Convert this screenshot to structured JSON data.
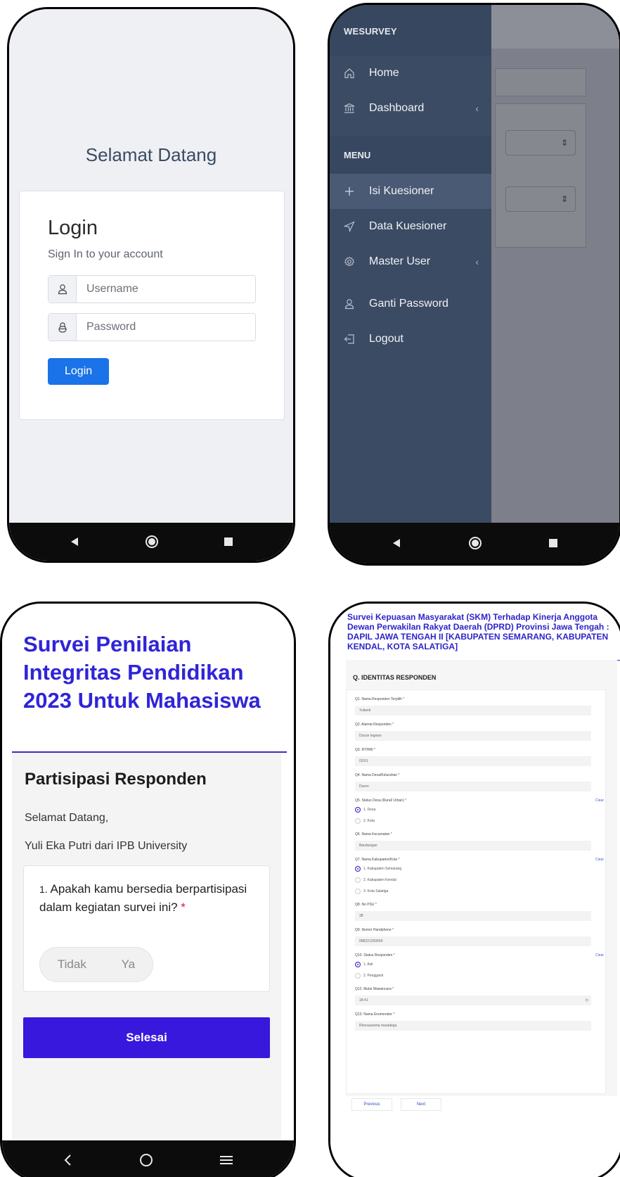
{
  "login_screen": {
    "welcome": "Selamat Datang",
    "title": "Login",
    "subtitle": "Sign In to your account",
    "username_placeholder": "Username",
    "password_placeholder": "Password",
    "login_button": "Login"
  },
  "sidebar_screen": {
    "brand": "WESURVEY",
    "items_top": [
      {
        "label": "Home",
        "icon": "home-icon"
      },
      {
        "label": "Dashboard",
        "icon": "bank-icon"
      }
    ],
    "menu_title": "MENU",
    "items_menu": [
      {
        "label": "Isi Kuesioner",
        "icon": "plus-icon"
      },
      {
        "label": "Data Kuesioner",
        "icon": "send-icon"
      },
      {
        "label": "Master User",
        "icon": "gear-icon"
      },
      {
        "label": "Ganti Password",
        "icon": "user-icon"
      },
      {
        "label": "Logout",
        "icon": "logout-icon"
      }
    ],
    "expand_marker": "‹"
  },
  "survey_screen": {
    "title": "Survei Penilaian Integritas Pendidikan 2023 Untuk Mahasiswa",
    "heading": "Partisipasi Responden",
    "greeting": "Selamat Datang,",
    "respondent": "Yuli Eka Putri dari IPB University",
    "question_number": "1.",
    "question_text": "Apakah kamu bersedia berpartisipasi dalam kegiatan survei ini?",
    "required_mark": "*",
    "option_no": "Tidak",
    "option_yes": "Ya",
    "submit": "Selesai"
  },
  "skm_screen": {
    "title": "Survei Kepuasan Masyarakat (SKM) Terhadap Kinerja Anggota Dewan Perwakilan Rakyat Daerah (DPRD) Provinsi Jawa Tengah : DAPIL JAWA TENGAH II [KABUPATEN SEMARANG, KABUPATEN KENDAL, KOTA SALATIGA]",
    "section": "Q. IDENTITAS RESPONDEN",
    "q1_label": "Q1. Nama Responden Terpilih",
    "q1_value": "Yulianti",
    "q2_label": "Q2. Alamat Responden",
    "q2_value": "Dusun legowo",
    "q3_label": "Q3. RT/RW",
    "q3_value": "02/01",
    "q4_label": "Q4. Nama Desa/Kelurahan",
    "q4_value": "Duren",
    "q5_label": "Q5. Status Desa (Rural/ Urban)",
    "q5_options": [
      "1. Desa",
      "2. Kota"
    ],
    "q6_label": "Q6. Nama Kecamatan",
    "q6_value": "Bandungan",
    "q7_label": "Q7. Nama Kabupaten/Kota",
    "q7_options": [
      "1. Kabupaten Semarang",
      "2. Kabupaten Kendal",
      "3. Kota Salatiga"
    ],
    "q8_label": "Q8. No PSU",
    "q8_value": "38",
    "q9_label": "Q9. Nomor Handphone",
    "q9_value": "088221200609",
    "q10_label": "Q10. Status Responden",
    "q10_options": [
      "1. Asli",
      "2. Pengganti"
    ],
    "q12_label": "Q12. Mulai Wawancara",
    "q12_value": "18:41",
    "q13_label": "Q13. Nama Enumerator",
    "q13_value": "Rhenasastria maradega",
    "clear": "Clear",
    "required_mark": "*",
    "previous": "Previous",
    "next": "Next"
  },
  "colors": {
    "sidebar": "#3c4b64",
    "primary_blue": "#1a73e8",
    "survey_purple": "#3718dc"
  }
}
